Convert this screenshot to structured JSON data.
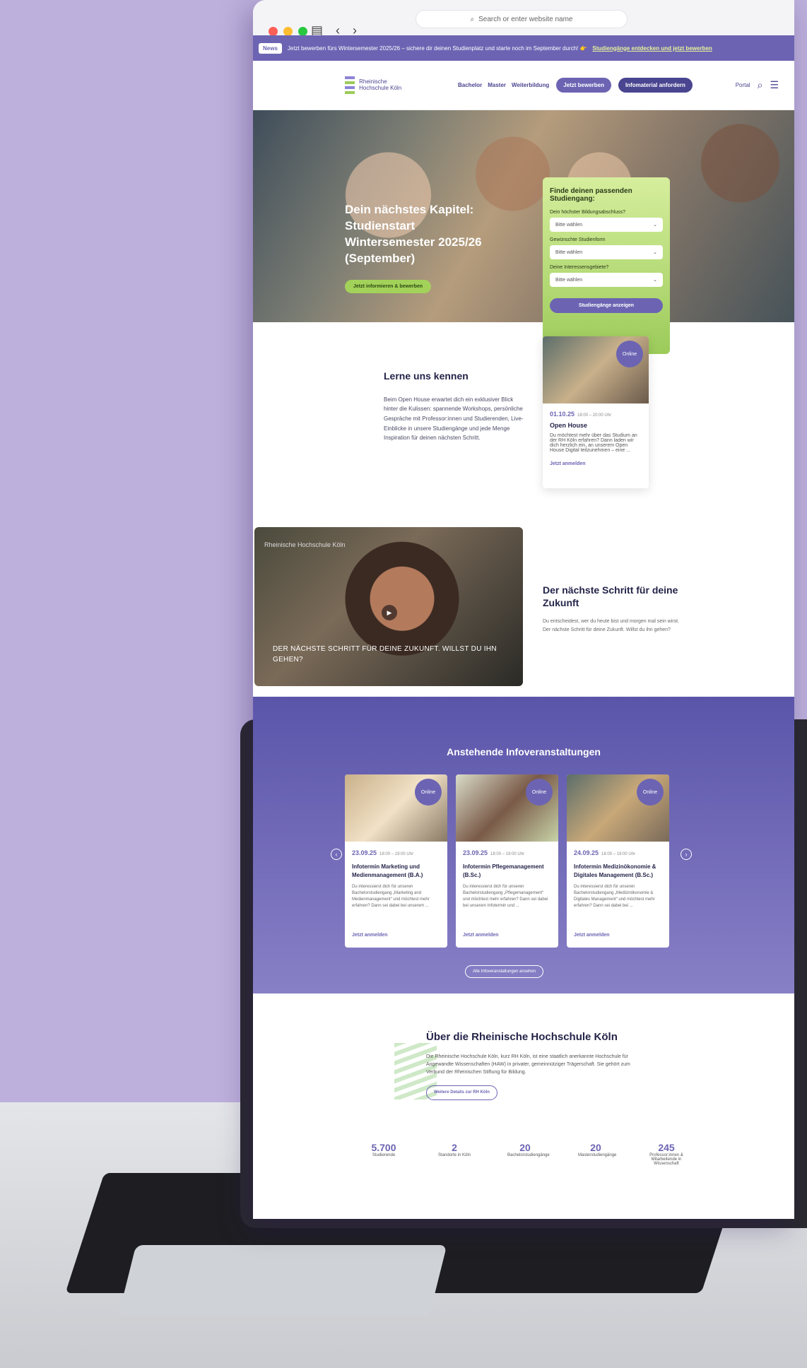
{
  "browser": {
    "address_placeholder": "Search or enter website name"
  },
  "banner": {
    "tag": "News",
    "text": "Jetzt bewerben fürs Wintersemester 2025/26 – sichere dir deinen Studienplatz und starte noch im September durch! 👉",
    "link": "Studiengänge entdecken und jetzt bewerben"
  },
  "nav": {
    "logo": "Rheinische Hochschule Köln",
    "links": [
      "Bachelor",
      "Master",
      "Weiterbildung"
    ],
    "apply": "Jetzt bewerben",
    "info": "Infomaterial anfordern",
    "portal": "Portal"
  },
  "hero": {
    "title": "Dein nächstes Kapitel: Studienstart Wintersemester 2025/26 (September)",
    "cta": "Jetzt informieren & bewerben"
  },
  "finder": {
    "title": "Finde deinen passenden Studiengang:",
    "q1": "Dein höchster Bildungsabschluss?",
    "q2": "Gewünschte Studienform",
    "q3": "Deine Interessensgebiete?",
    "placeholder": "Bitte wählen",
    "submit": "Studiengänge anzeigen"
  },
  "intro": {
    "title": "Lerne uns kennen",
    "text": "Beim Open House erwartet dich ein exklusiver Blick hinter die Kulissen: spannende Workshops, persönliche Gespräche mit Professor:innen und Studierenden, Live-Einblicke in unsere Studiengänge und jede Menge Inspiration für deinen nächsten Schritt."
  },
  "open_house": {
    "badge": "Online",
    "date": "01.10.25",
    "time": "18:00 – 20:00 Uhr",
    "title": "Open House",
    "text": "Du möchtest mehr über das Studium an der RH Köln erfahren? Dann laden wir dich herzlich ein, an unserem Open House Digital teilzunehmen – eine ...",
    "signup": "Jetzt anmelden"
  },
  "video": {
    "logo": "Rheinische Hochschule Köln",
    "caption": "DER NÄCHSTE SCHRITT FÜR DEINE ZUKUNFT. WILLST DU IHN GEHEN?"
  },
  "next": {
    "title": "Der nächste Schritt für deine Zukunft",
    "text": "Du entscheidest, wer du heute bist und morgen mal sein wirst. Der nächste Schritt für deine Zukunft. Willst du ihn gehen?"
  },
  "events": {
    "title": "Anstehende Infoveranstaltungen",
    "all": "Alle Infoveranstaltungen ansehen",
    "cards": [
      {
        "badge": "Online",
        "date": "23.09.25",
        "time": "18:00 – 19:00 Uhr",
        "title": "Infotermin Marketing und Medienmanagement (B.A.)",
        "text": "Du interessierst dich für unseren Bachelorstudiengang „Marketing and Medienmanagement“ und möchtest mehr erfahren? Dann sei dabei bei unserem ...",
        "signup": "Jetzt anmelden"
      },
      {
        "badge": "Online",
        "date": "23.09.25",
        "time": "18:00 – 19:00 Uhr",
        "title": "Infotermin Pflegemanagement (B.Sc.)",
        "text": "Du interessierst dich für unseren Bachelorstudiengang „Pflegemanagement“ und möchtest mehr erfahren? Dann sei dabei bei unserem Infotermin und ...",
        "signup": "Jetzt anmelden"
      },
      {
        "badge": "Online",
        "date": "24.09.25",
        "time": "18:00 – 19:00 Uhr",
        "title": "Infotermin Medizinökonomie & Digitales Management (B.Sc.)",
        "text": "Du interessierst dich für unseren Bachelorstudiengang „Medizinökonomie & Digitales Management“ und möchtest mehr erfahren? Dann sei dabei bei ...",
        "signup": "Jetzt anmelden"
      }
    ]
  },
  "about": {
    "title": "Über die Rheinische Hochschule Köln",
    "text": "Die Rheinische Hochschule Köln, kurz RH Köln, ist eine staatlich anerkannte Hochschule für Angewandte Wissenschaften (HAW) in privater, gemeinnütziger Trägerschaft. Sie gehört zum Verbund der Rheinischen Stiftung für Bildung.",
    "button": "Weitere Details zur RH Köln"
  },
  "stats": [
    {
      "num": "5.700",
      "label": "Studierende"
    },
    {
      "num": "2",
      "label": "Standorte in Köln"
    },
    {
      "num": "20",
      "label": "Bachelorstudiengänge"
    },
    {
      "num": "20",
      "label": "Masterstudiengänge"
    },
    {
      "num": "245",
      "label": "Professor:innen & Mitarbeitende in Wissenschaft"
    }
  ]
}
